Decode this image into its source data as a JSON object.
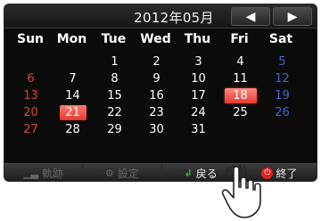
{
  "header": {
    "month_title": "2012年05月",
    "prev_label": "◀",
    "next_label": "▶"
  },
  "weekdays": [
    "Sun",
    "Mon",
    "Tue",
    "Wed",
    "Thu",
    "Fri",
    "Sat"
  ],
  "weeks": [
    [
      "",
      "",
      "1",
      "2",
      "3",
      "4",
      "5"
    ],
    [
      "6",
      "7",
      "8",
      "9",
      "10",
      "11",
      "12"
    ],
    [
      "13",
      "14",
      "15",
      "16",
      "17",
      "18",
      "19"
    ],
    [
      "20",
      "21",
      "22",
      "23",
      "24",
      "25",
      "26"
    ],
    [
      "27",
      "28",
      "29",
      "30",
      "31",
      "",
      ""
    ]
  ],
  "today": "18",
  "selected": "21",
  "toolbar": {
    "track_label": "軌跡",
    "settings_label": "設定",
    "back_label": "戻る",
    "exit_label": "終了"
  },
  "colors": {
    "sunday": "#e0443c",
    "saturday": "#3b68c9",
    "highlight": "#e8382c"
  }
}
